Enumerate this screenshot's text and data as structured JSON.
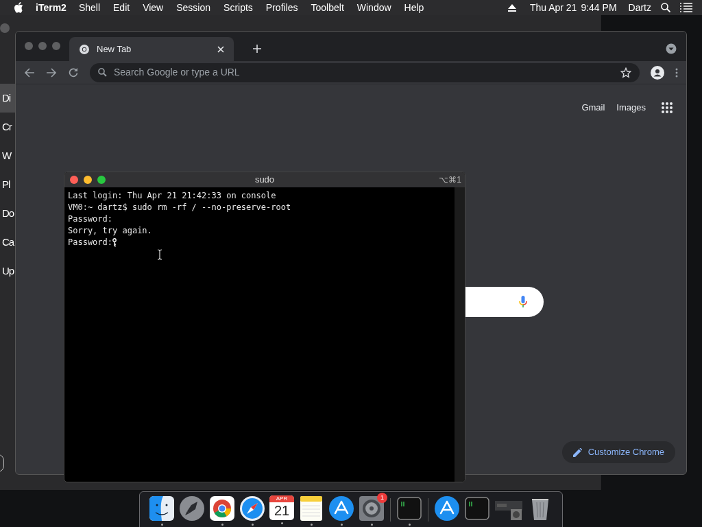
{
  "menu_bar": {
    "app_name": "iTerm2",
    "items": [
      "Shell",
      "Edit",
      "View",
      "Session",
      "Scripts",
      "Profiles",
      "Toolbelt",
      "Window",
      "Help"
    ],
    "date": "Thu Apr 21",
    "time": "9:44 PM",
    "user": "Dartz"
  },
  "background_app": {
    "sidebar_items": [
      {
        "label": "Di",
        "selected": true
      },
      {
        "label": "Cr",
        "selected": false
      },
      {
        "label": "W",
        "selected": false
      },
      {
        "label": "Pl",
        "selected": false
      },
      {
        "label": "Do",
        "selected": false
      },
      {
        "label": "Ca",
        "selected": false
      },
      {
        "label": "Up",
        "selected": false
      }
    ]
  },
  "browser": {
    "tab": {
      "title": "New Tab"
    },
    "omnibox": {
      "placeholder": "Search Google or type a URL"
    },
    "links": [
      "Gmail",
      "Images"
    ],
    "customize_button": "Customize Chrome"
  },
  "terminal": {
    "title": "sudo",
    "shortcut": "⌥⌘1",
    "lines": [
      "Last login: Thu Apr 21 21:42:33 on console",
      "VM0:~ dartz$ sudo rm -rf / --no-preserve-root",
      "Password:",
      "Sorry, try again.",
      "Password:"
    ]
  },
  "dock": {
    "items": [
      {
        "kind": "finder",
        "running": true
      },
      {
        "kind": "launchpad",
        "running": false
      },
      {
        "kind": "chrome",
        "running": true
      },
      {
        "kind": "safari",
        "running": true
      },
      {
        "kind": "calendar",
        "running": true,
        "month": "APR",
        "day": "21"
      },
      {
        "kind": "notes",
        "running": true
      },
      {
        "kind": "appstore",
        "running": true
      },
      {
        "kind": "settings",
        "running": true,
        "badge": "1"
      },
      {
        "kind": "divider"
      },
      {
        "kind": "terminal",
        "running": true
      },
      {
        "kind": "divider"
      },
      {
        "kind": "appstore",
        "running": false
      },
      {
        "kind": "terminal",
        "running": false
      },
      {
        "kind": "window",
        "running": false
      },
      {
        "kind": "trash",
        "running": false
      }
    ]
  }
}
